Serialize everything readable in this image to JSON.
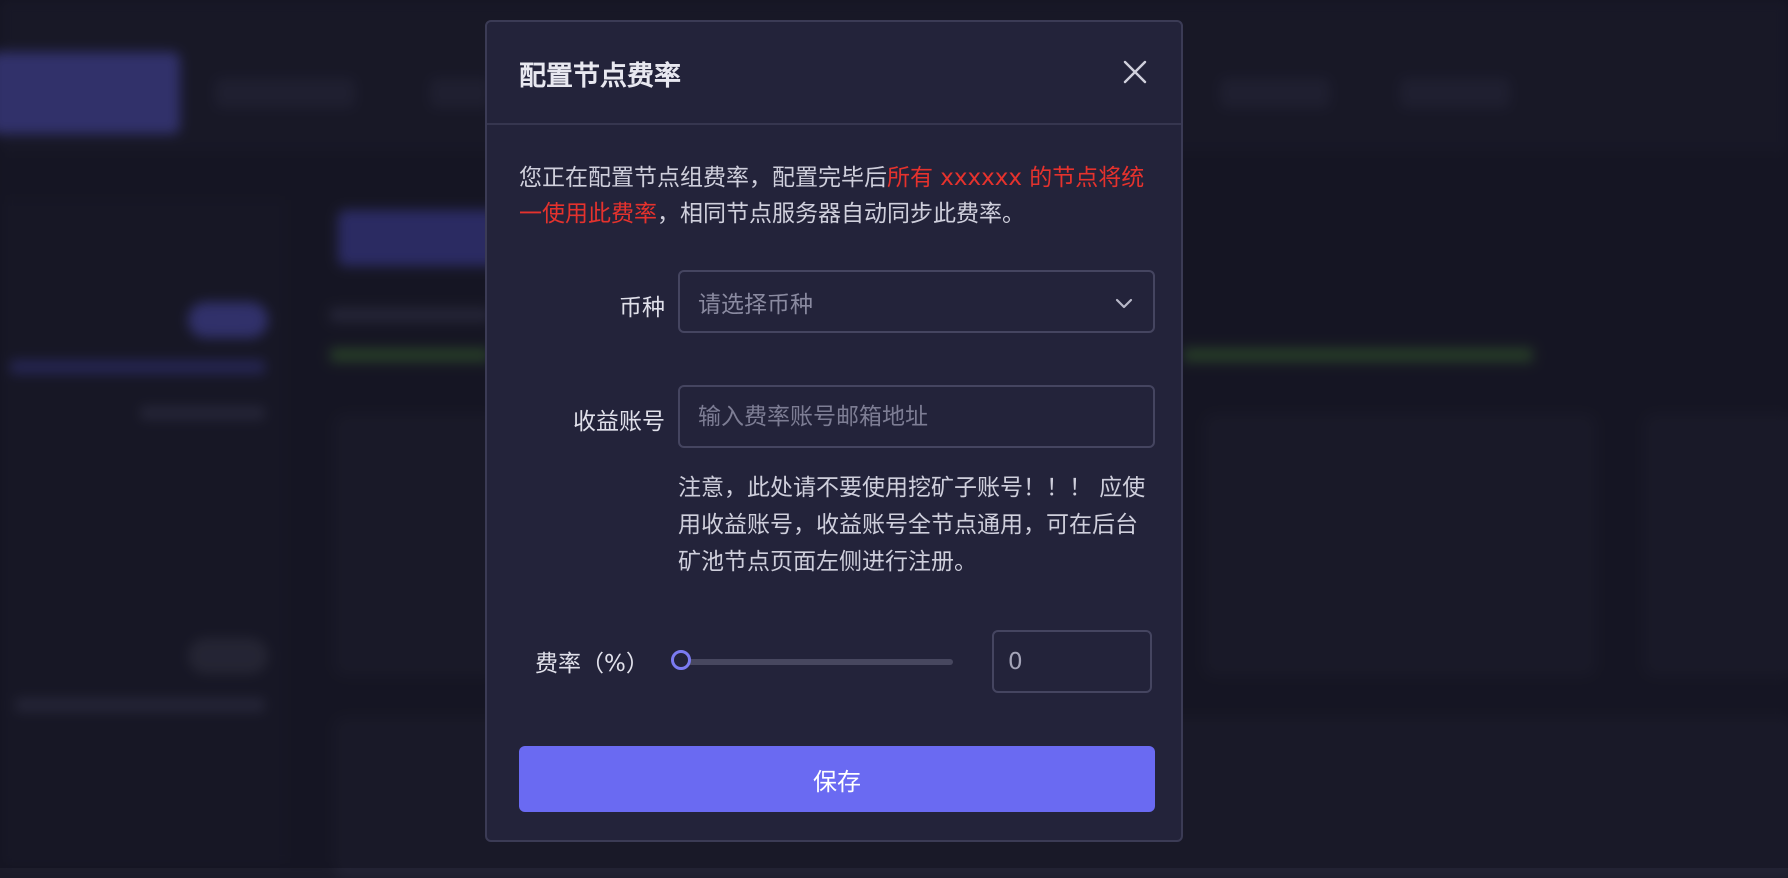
{
  "modal": {
    "title": "配置节点费率",
    "intro": {
      "prefix": "您正在配置节点组费率，配置完毕后",
      "highlight": "所有 xxxxxx 的节点将统一使用此费率",
      "suffix": "，相同节点服务器自动同步此费率。"
    },
    "currency": {
      "label": "币种",
      "placeholder": "请选择币种"
    },
    "account": {
      "label": "收益账号",
      "placeholder": "输入费率账号邮箱地址",
      "notice": "注意，此处请不要使用挖矿子账号！！！ 应使用收益账号，收益账号全节点通用，可在后台矿池节点页面左侧进行注册。"
    },
    "rate": {
      "label": "费率（%）",
      "value": "0",
      "slider_value": 0
    },
    "save_label": "保存"
  },
  "colors": {
    "accent": "#6a6af2",
    "highlight": "#e5322d",
    "modal_bg": "#23233a"
  }
}
